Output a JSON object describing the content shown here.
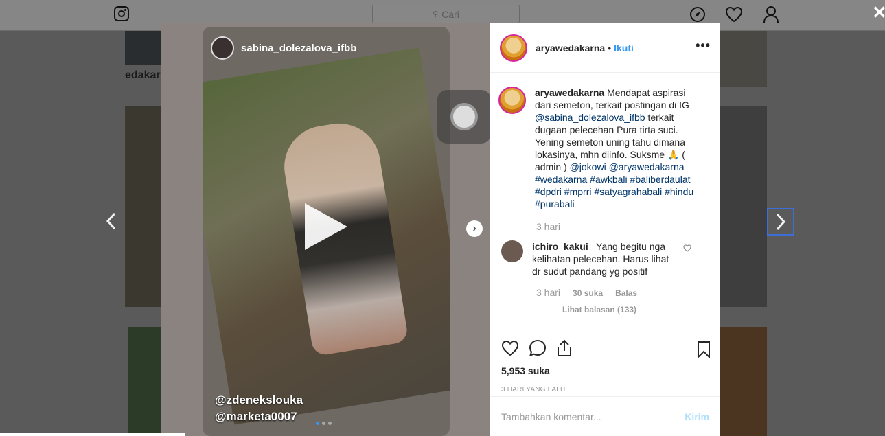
{
  "nav": {
    "search_placeholder": "Cari",
    "icons": [
      "instagram-icon",
      "search-icon",
      "compass-icon",
      "heart-icon",
      "user-icon",
      "close-icon"
    ]
  },
  "background": {
    "partial_username": "edakarn"
  },
  "story": {
    "username": "sabina_dolezalova_ifbb",
    "tag1": "@zdenekslouka",
    "tag2": "@marketa0007"
  },
  "post": {
    "username": "aryawedakarna",
    "separator": "•",
    "follow_label": "Ikuti",
    "more_label": "•••",
    "caption_user": "aryawedakarna",
    "caption_text": " Mendapat aspirasi dari semeton, terkait postingan di IG ",
    "caption_mention1": "@sabina_dolezalova_ifbb",
    "caption_text2": " terkait dugaan pelecehan Pura tirta suci. Yening semeton uning tahu dimana lokasinya, mhn diinfo. Suksme 🙏 ( admin ) ",
    "caption_mention2": "@jokowi",
    "caption_mention3": "@aryawedakarna",
    "caption_hashtags": "#wedakarna #awkbali #baliberdaulat #dpdri #mprri #satyagrahabali #hindu #purabali",
    "caption_time": "3 hari",
    "comment": {
      "user": "ichiro_kakui_",
      "text": "Yang begitu nga kelihatan pelecehan. Harus lihat dr sudut pandang yg positif",
      "time": "3 hari",
      "likes": "30 suka",
      "reply_label": "Balas",
      "view_replies": "Lihat balasan (133)"
    },
    "likes": "5,953 suka",
    "date": "3 HARI YANG LALU",
    "comment_placeholder": "Tambahkan komentar...",
    "post_label": "Kirim"
  },
  "colors": {
    "accent": "#3897f0",
    "link": "#003569",
    "muted": "#999999",
    "post_disabled": "#b2dffc"
  }
}
